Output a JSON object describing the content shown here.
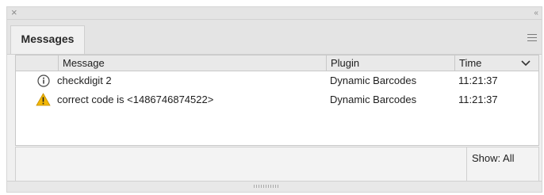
{
  "panel": {
    "close_glyph": "×",
    "collapse_glyph": "‹‹",
    "tab_label": "Messages"
  },
  "table": {
    "columns": [
      "Message",
      "Plugin",
      "Time"
    ],
    "rows": [
      {
        "icon": "info-icon",
        "message": "checkdigit 2",
        "plugin": "Dynamic Barcodes",
        "time": "11:21:37"
      },
      {
        "icon": "warning-icon",
        "message": "correct code is <1486746874522>",
        "plugin": "Dynamic Barcodes",
        "time": "11:21:37"
      }
    ]
  },
  "footer": {
    "show_label": "Show: All"
  },
  "colors": {
    "warning_fill": "#f2b705",
    "info_stroke": "#444444"
  }
}
